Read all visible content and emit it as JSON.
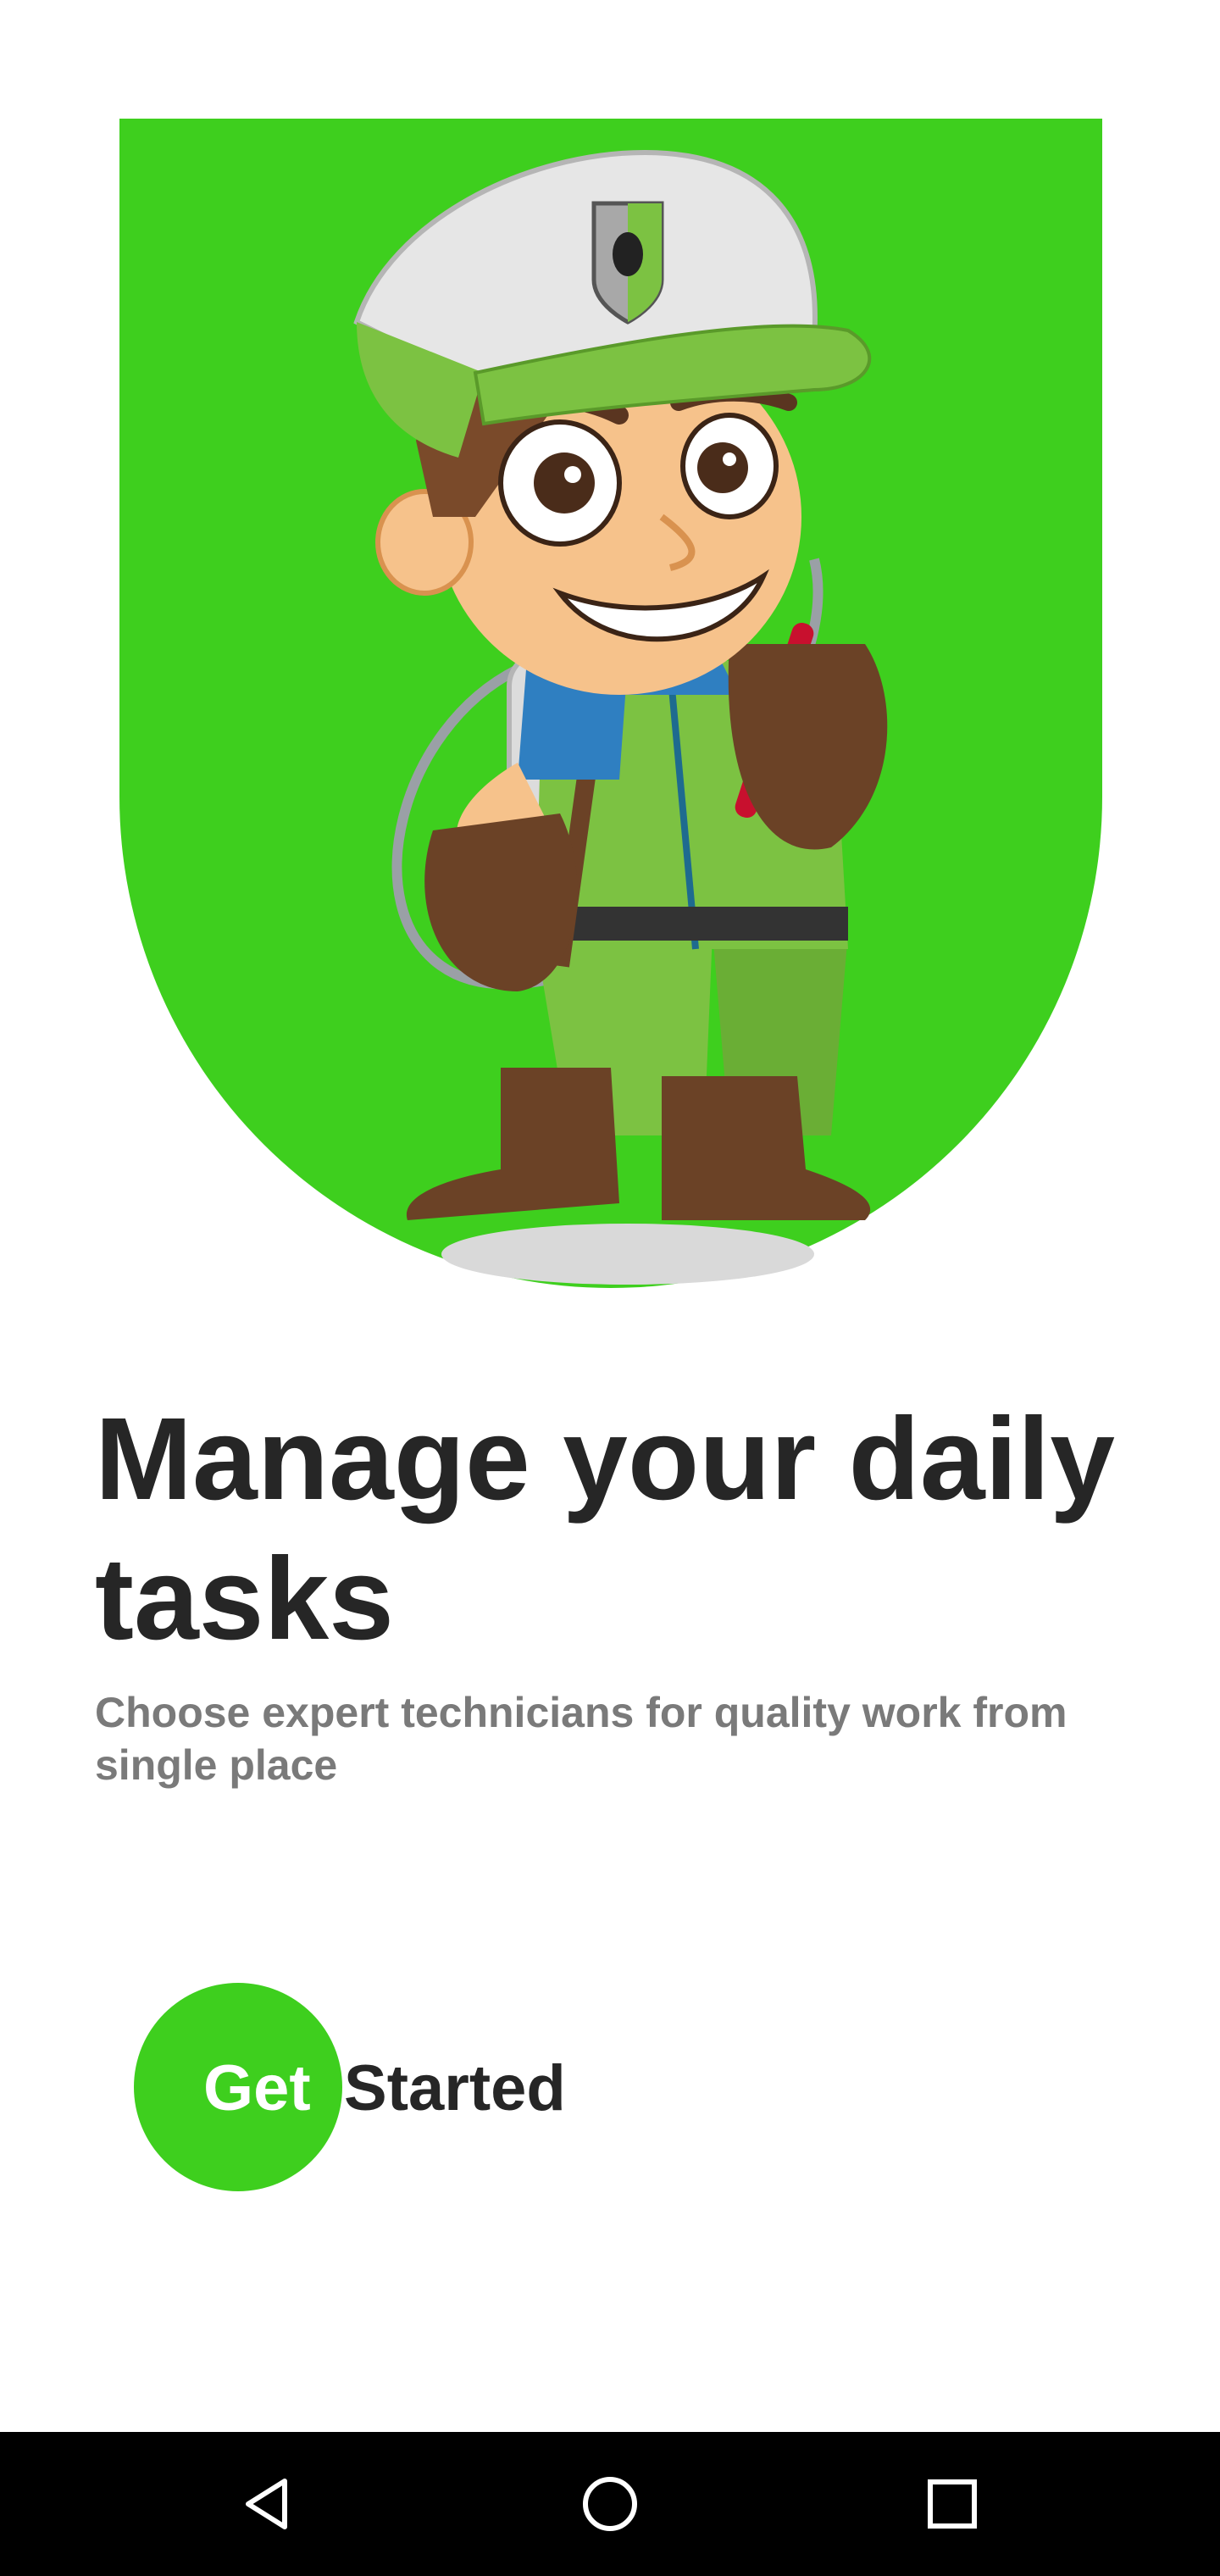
{
  "onboarding": {
    "headline": "Manage your daily tasks",
    "subheadline": "Choose expert technicians for quality work from single place",
    "cta": {
      "part1": "Get",
      "part2": "Started"
    },
    "illustration": "pest-control-technician-mascot"
  },
  "navigation_bar": {
    "buttons": [
      "back-icon",
      "home-icon",
      "recents-icon"
    ]
  },
  "colors": {
    "brand_green": "#3ecf1e",
    "headline_text": "#262626",
    "subheadline_text": "#7a7a7a",
    "nav_background": "#000000"
  }
}
